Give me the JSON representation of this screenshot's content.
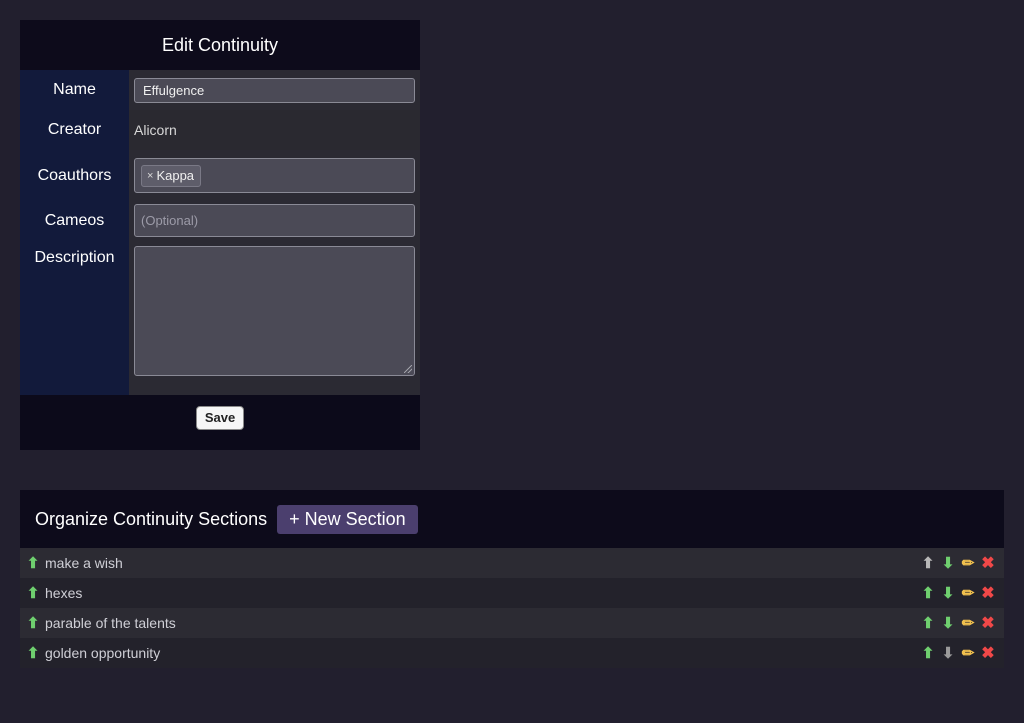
{
  "edit_panel": {
    "title": "Edit Continuity",
    "name_label": "Name",
    "name_value": "Effulgence",
    "creator_label": "Creator",
    "creator_value": "Alicorn",
    "coauthors_label": "Coauthors",
    "coauthors": [
      {
        "remove": "×",
        "name": "Kappa"
      }
    ],
    "cameos_label": "Cameos",
    "cameos_placeholder": "(Optional)",
    "description_label": "Description",
    "description_value": "",
    "save_label": "Save"
  },
  "sections_panel": {
    "title": "Organize Continuity Sections",
    "new_section_label": "+ New Section",
    "rows": [
      {
        "title": "make a wish",
        "up_enabled": false,
        "down_enabled": true
      },
      {
        "title": "hexes",
        "up_enabled": true,
        "down_enabled": true
      },
      {
        "title": "parable of the talents",
        "up_enabled": true,
        "down_enabled": true
      },
      {
        "title": "golden opportunity",
        "up_enabled": true,
        "down_enabled": false
      }
    ],
    "icons": {
      "drag": "up-arrow-icon",
      "up": "move-up-icon",
      "down": "move-down-icon",
      "edit": "pencil-icon",
      "delete": "delete-x-icon"
    },
    "glyphs": {
      "drag": "⬆",
      "up": "⬆",
      "down": "⬇",
      "edit": "✏",
      "delete": "✖"
    }
  },
  "colors": {
    "background": "#221f2e",
    "label_column": "#121a3b",
    "accent_button": "#4b3f6e",
    "enabled_arrow": "#6fcf6f",
    "delete": "#f04848",
    "edit": "#f2c14e"
  }
}
